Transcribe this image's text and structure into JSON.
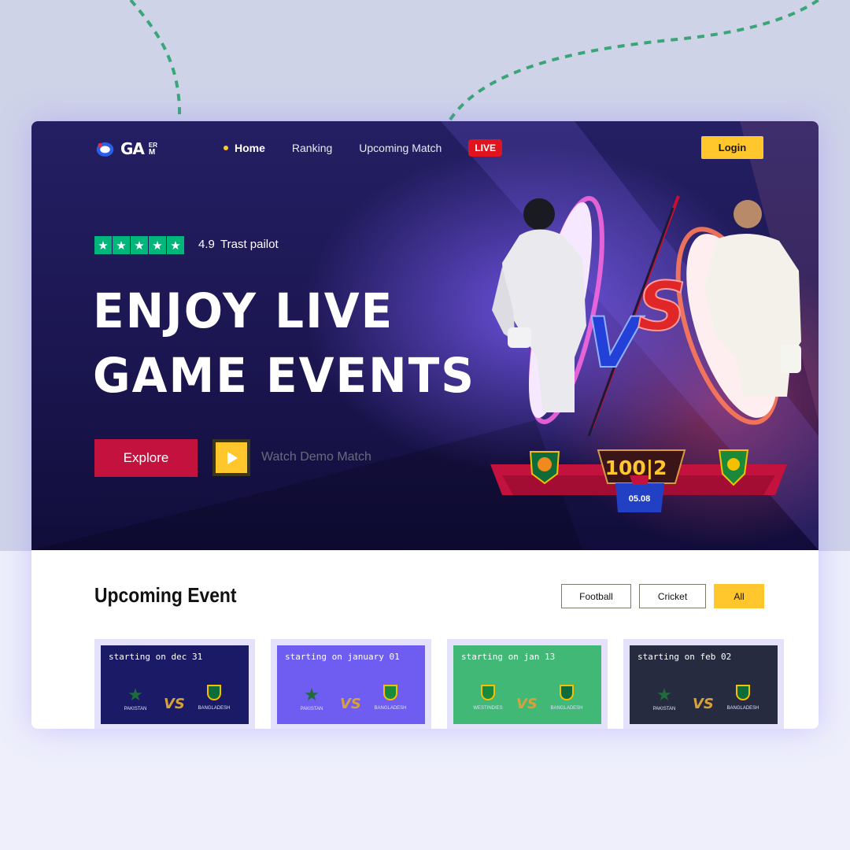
{
  "nav": {
    "logo_text": "GA",
    "logo_sup": "ER",
    "logo_sub": "M",
    "items": [
      {
        "label": "Home",
        "active": true
      },
      {
        "label": "Ranking",
        "active": false
      },
      {
        "label": "Upcoming Match",
        "active": false
      }
    ],
    "live_label": "LIVE",
    "login_label": "Login"
  },
  "hero": {
    "rating_value": "4.9",
    "rating_label": "Trast pailot",
    "headline_line1": "ENJOY LIVE",
    "headline_line2": "GAME EVENTS",
    "explore_label": "Explore",
    "demo_label": "Watch Demo Match",
    "vs_text": "VS",
    "score": "100|2",
    "date": "05.08"
  },
  "upcoming": {
    "title": "Upcoming Event",
    "filters": [
      {
        "label": "Football",
        "active": false
      },
      {
        "label": "Cricket",
        "active": false
      },
      {
        "label": "All",
        "active": true
      }
    ],
    "cards": [
      {
        "title": "starting on dec 31",
        "bg": "#1a1a66",
        "team_a": "PAKISTAN",
        "team_b": "BANGLADESH",
        "logo_a": "star-emblem",
        "logo_b": "tiger-emblem"
      },
      {
        "title": "starting on january 01",
        "bg": "#6f5cf0",
        "team_a": "PAKISTAN",
        "team_b": "BANGLADESH",
        "logo_a": "star-emblem",
        "logo_b": "aus-emblem"
      },
      {
        "title": "starting on jan 13",
        "bg": "#42b877",
        "team_a": "WESTINDIES",
        "team_b": "BANGLADESH",
        "logo_a": "aus-emblem",
        "logo_b": "tiger-emblem"
      },
      {
        "title": "starting on feb 02",
        "bg": "#262b40",
        "team_a": "PAKISTAN",
        "team_b": "BANGLADESH",
        "logo_a": "star-emblem",
        "logo_b": "tiger-emblem"
      }
    ]
  },
  "colors": {
    "accent_yellow": "#ffc72c",
    "explore_red": "#c4123f",
    "live_red": "#e0141e",
    "trust_green": "#00b67a"
  }
}
